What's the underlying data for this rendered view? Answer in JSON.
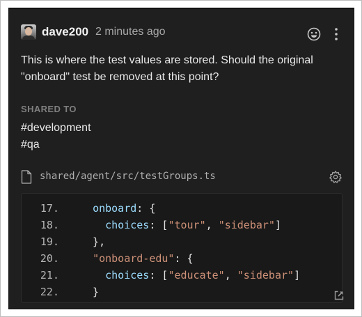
{
  "comment": {
    "author": "dave200",
    "timestamp": "2 minutes ago",
    "message": "This is where the test values are stored. Should the original \"onboard\" test be removed at this point?",
    "shared_to_label": "SHARED TO",
    "channels": [
      "#development",
      "#qa"
    ]
  },
  "snippet": {
    "file_path": "shared/agent/src/testGroups.ts",
    "lines": [
      {
        "n": "17.",
        "parts": [
          {
            "t": "  ",
            "c": "punc"
          },
          {
            "t": "onboard",
            "c": "key"
          },
          {
            "t": ": {",
            "c": "punc"
          }
        ]
      },
      {
        "n": "18.",
        "parts": [
          {
            "t": "    ",
            "c": "punc"
          },
          {
            "t": "choices",
            "c": "key"
          },
          {
            "t": ": [",
            "c": "punc"
          },
          {
            "t": "\"tour\"",
            "c": "str"
          },
          {
            "t": ", ",
            "c": "punc"
          },
          {
            "t": "\"sidebar\"",
            "c": "str"
          },
          {
            "t": "]",
            "c": "punc"
          }
        ]
      },
      {
        "n": "19.",
        "parts": [
          {
            "t": "  },",
            "c": "punc"
          }
        ]
      },
      {
        "n": "20.",
        "parts": [
          {
            "t": "  ",
            "c": "punc"
          },
          {
            "t": "\"onboard-edu\"",
            "c": "str"
          },
          {
            "t": ": {",
            "c": "punc"
          }
        ]
      },
      {
        "n": "21.",
        "parts": [
          {
            "t": "    ",
            "c": "punc"
          },
          {
            "t": "choices",
            "c": "key"
          },
          {
            "t": ": [",
            "c": "punc"
          },
          {
            "t": "\"educate\"",
            "c": "str"
          },
          {
            "t": ", ",
            "c": "punc"
          },
          {
            "t": "\"sidebar\"",
            "c": "str"
          },
          {
            "t": "]",
            "c": "punc"
          }
        ]
      },
      {
        "n": "22.",
        "parts": [
          {
            "t": "  }",
            "c": "punc"
          }
        ]
      }
    ]
  },
  "icons": {
    "emoji": "smiley-face-icon",
    "more": "vertical-ellipsis-icon",
    "file": "file-icon",
    "settings": "gear-icon",
    "open": "open-external-icon"
  },
  "colors": {
    "card_background": "#1f1f1f",
    "code_key": "#9cdcfe",
    "code_string": "#ce9178"
  }
}
